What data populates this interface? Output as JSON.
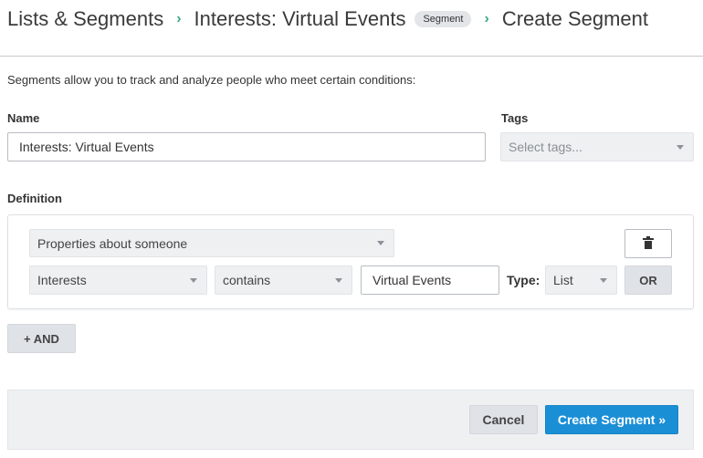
{
  "breadcrumb": {
    "lists_label": "Lists & Segments",
    "segment_name": "Interests: Virtual Events",
    "badge": "Segment",
    "current": "Create Segment"
  },
  "intro_text": "Segments allow you to track and analyze people who meet certain conditions:",
  "name_field": {
    "label": "Name",
    "value": "Interests: Virtual Events"
  },
  "tags_field": {
    "label": "Tags",
    "placeholder": "Select tags..."
  },
  "definition": {
    "label": "Definition",
    "condition_type": "Properties about someone",
    "property": "Interests",
    "operator": "contains",
    "value": "Virtual Events",
    "type_label": "Type:",
    "type_value": "List",
    "or_label": "OR"
  },
  "and_button": "+ AND",
  "footer": {
    "cancel": "Cancel",
    "create": "Create Segment »"
  },
  "colors": {
    "accent": "#1b8fd6",
    "chevron": "#3ba68a"
  }
}
